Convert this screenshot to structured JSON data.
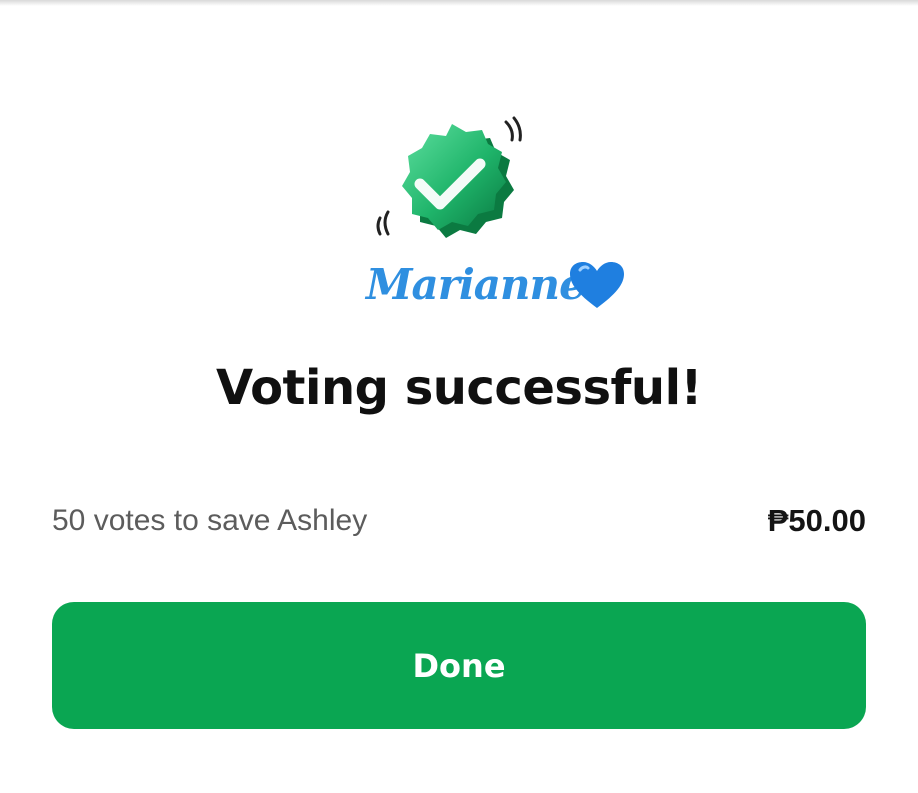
{
  "dialog": {
    "title": "Voting successful!",
    "summary": {
      "label": "50 votes to save Ashley",
      "amount": "₱50.00"
    },
    "done_label": "Done"
  },
  "overlay": {
    "signature_text": "Marianne"
  },
  "icons": {
    "badge": "check-badge-icon",
    "heart": "blue-heart-icon"
  },
  "colors": {
    "primary_green": "#0aa652",
    "badge_green": "#1fb46a",
    "signature_blue": "#2f8fe0",
    "title_text": "#101010",
    "muted_text": "#5c5c5c"
  }
}
